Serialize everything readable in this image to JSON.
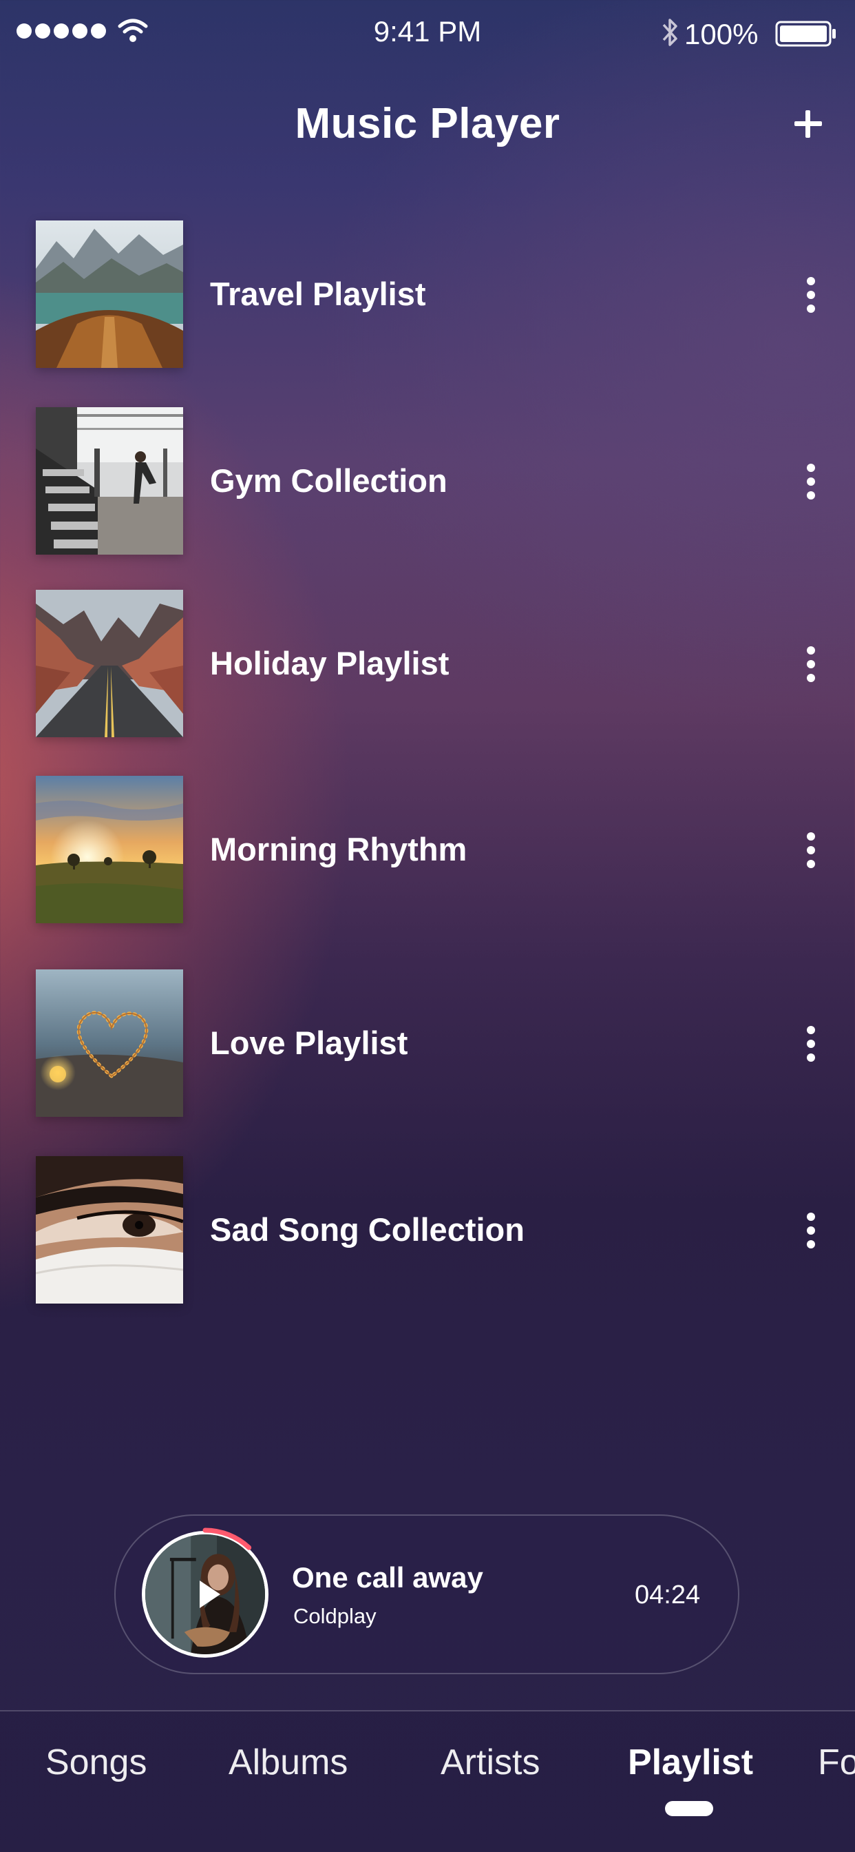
{
  "status_bar": {
    "time": "9:41 PM",
    "battery_percent": "100%",
    "signal_icon": "signal-dots-icon",
    "wifi_icon": "wifi-icon",
    "bluetooth_icon": "bluetooth-icon",
    "battery_icon": "battery-icon"
  },
  "header": {
    "title": "Music Player",
    "add_icon": "plus-icon"
  },
  "playlists": [
    {
      "label": "Travel Playlist",
      "thumb": "mountain-lake-boat-image"
    },
    {
      "label": "Gym Collection",
      "thumb": "gym-dumbbells-image"
    },
    {
      "label": "Holiday Playlist",
      "thumb": "desert-road-image"
    },
    {
      "label": "Morning Rhythm",
      "thumb": "sunrise-field-image"
    },
    {
      "label": "Love Playlist",
      "thumb": "heart-lights-image"
    },
    {
      "label": "Sad Song Collection",
      "thumb": "eye-closeup-image"
    }
  ],
  "now_playing": {
    "title": "One call away",
    "artist": "Coldplay",
    "duration": "04:24",
    "progress": 0.12,
    "progress_color": "#ff5a6e"
  },
  "tabs": [
    {
      "label": "Songs",
      "active": false
    },
    {
      "label": "Albums",
      "active": false
    },
    {
      "label": "Artists",
      "active": false
    },
    {
      "label": "Playlist",
      "active": true
    },
    {
      "label": "Fo",
      "active": false
    }
  ]
}
